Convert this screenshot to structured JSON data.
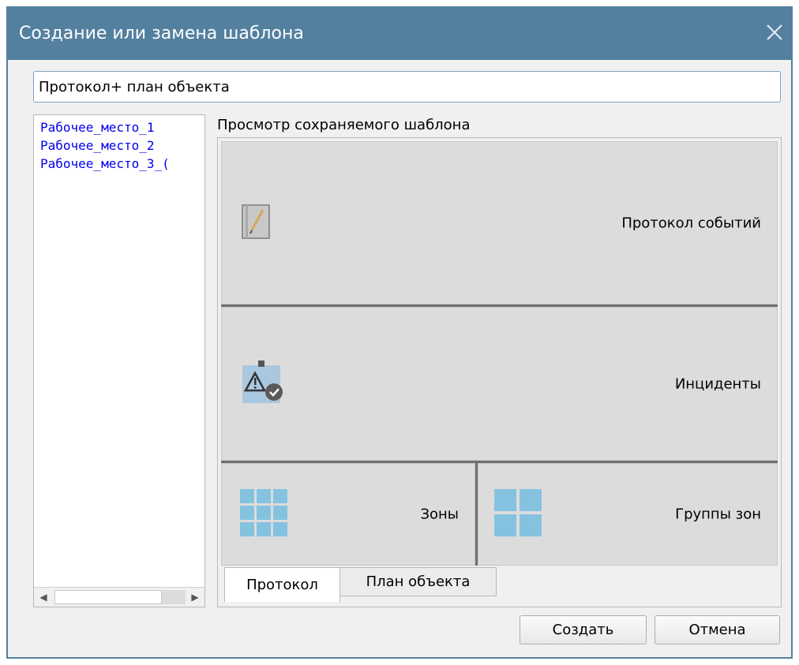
{
  "dialog": {
    "title": "Создание или замена шаблона",
    "titlebar_color": "#5480a0"
  },
  "name_input": {
    "value": "Протокол+ план объекта"
  },
  "workplaces": {
    "items": [
      {
        "label": "Рабочее_место_1"
      },
      {
        "label": "Рабочее_место_2"
      },
      {
        "label": "Рабочее_место_3_("
      }
    ]
  },
  "preview": {
    "label": "Просмотр сохраняемого шаблона",
    "panels": [
      {
        "label": "Протокол событий",
        "icon": "notebook-icon"
      },
      {
        "label": "Инциденты",
        "icon": "incident-clipboard-icon"
      },
      {
        "label": "Зоны",
        "icon": "zones-grid-icon"
      },
      {
        "label": "Группы зон",
        "icon": "zone-groups-grid-icon"
      }
    ],
    "tabs": [
      {
        "label": "Протокол",
        "active": true
      },
      {
        "label": "План объекта",
        "active": false
      }
    ]
  },
  "buttons": {
    "create": "Создать",
    "cancel": "Отмена"
  }
}
